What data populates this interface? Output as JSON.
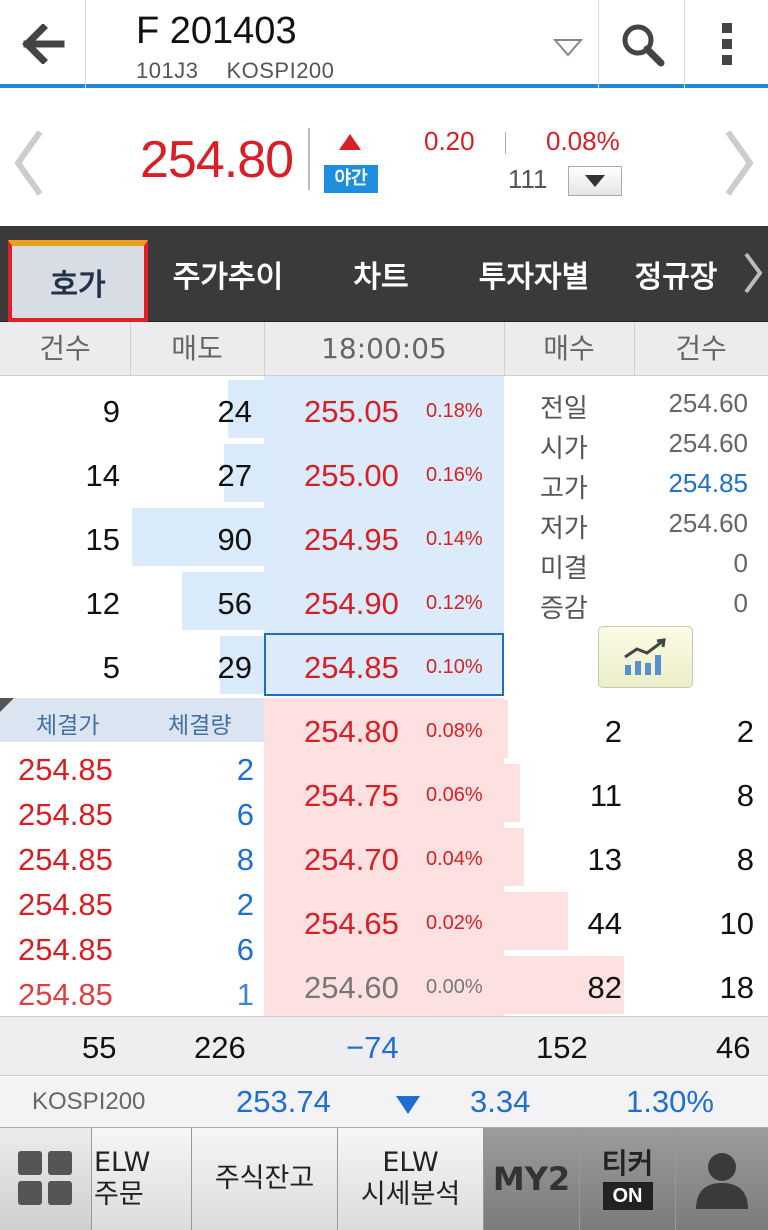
{
  "header": {
    "title": "F 201403",
    "code": "101J3",
    "market": "KOSPI200"
  },
  "quote": {
    "price": "254.80",
    "session_badge": "야간",
    "change": "0.20",
    "change_pct": "0.08%",
    "volume": "111"
  },
  "tabs": [
    "호가",
    "주가추이",
    "차트",
    "투자자별",
    "정규장"
  ],
  "columns": {
    "count_left": "건수",
    "sell": "매도",
    "time": "18:00:05",
    "buy": "매수",
    "count_right": "건수"
  },
  "asks": [
    {
      "count": "9",
      "qty": "24",
      "price": "255.05",
      "pct": "0.18%"
    },
    {
      "count": "14",
      "qty": "27",
      "price": "255.00",
      "pct": "0.16%"
    },
    {
      "count": "15",
      "qty": "90",
      "price": "254.95",
      "pct": "0.14%"
    },
    {
      "count": "12",
      "qty": "56",
      "price": "254.90",
      "pct": "0.12%"
    },
    {
      "count": "5",
      "qty": "29",
      "price": "254.85",
      "pct": "0.10%"
    }
  ],
  "bids": [
    {
      "price": "254.80",
      "pct": "0.08%",
      "qty": "2",
      "count": "2"
    },
    {
      "price": "254.75",
      "pct": "0.06%",
      "qty": "11",
      "count": "8"
    },
    {
      "price": "254.70",
      "pct": "0.04%",
      "qty": "13",
      "count": "8"
    },
    {
      "price": "254.65",
      "pct": "0.02%",
      "qty": "44",
      "count": "10"
    },
    {
      "price": "254.60",
      "pct": "0.00%",
      "qty": "82",
      "count": "18"
    }
  ],
  "summary": [
    {
      "label": "전일",
      "value": "254.60"
    },
    {
      "label": "시가",
      "value": "254.60"
    },
    {
      "label": "고가",
      "value": "254.85"
    },
    {
      "label": "저가",
      "value": "254.60"
    },
    {
      "label": "미결",
      "value": "0"
    },
    {
      "label": "증감",
      "value": "0"
    }
  ],
  "trades": {
    "header_price": "체결가",
    "header_qty": "체결량",
    "rows": [
      {
        "price": "254.85",
        "qty": "2"
      },
      {
        "price": "254.85",
        "qty": "6"
      },
      {
        "price": "254.85",
        "qty": "8"
      },
      {
        "price": "254.85",
        "qty": "2"
      },
      {
        "price": "254.85",
        "qty": "6"
      },
      {
        "price": "254.85",
        "qty": "1"
      }
    ]
  },
  "totals": {
    "ask_count": "55",
    "ask_qty": "226",
    "diff": "−74",
    "bid_qty": "152",
    "bid_count": "46"
  },
  "index": {
    "name": "KOSPI200",
    "value": "253.74",
    "change": "3.34",
    "change_pct": "1.30%"
  },
  "bottom_bar": {
    "elw_order_1": "ELW",
    "elw_order_2": "주문",
    "balance": "주식잔고",
    "elw_analysis_1": "ELW",
    "elw_analysis_2": "시세분석",
    "my2": "MY2",
    "ticker": "티커",
    "ticker_state": "ON"
  },
  "colors": {
    "up": "#d81f26",
    "down": "#1e6fd0",
    "accent": "#1e88d8",
    "ask_bg": "#d9ebfa",
    "bid_bg": "#fde0e0"
  }
}
